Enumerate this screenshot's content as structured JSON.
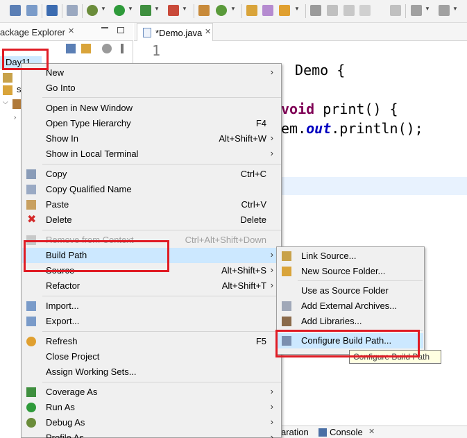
{
  "toolbar": {
    "icons": [
      "save-all-icon",
      "print-icon",
      "debug-icon",
      "run-icon",
      "coverage-icon",
      "external-tools-icon",
      "new-java-project-icon",
      "new-class-icon",
      "open-type-icon",
      "search-icon",
      "pin-icon",
      "annotation-icon",
      "paragraph-icon",
      "nav-back-icon",
      "nav-forward-icon"
    ]
  },
  "package_explorer": {
    "title": "ackage Explorer",
    "tree": [
      {
        "label": "Day11",
        "selected": true
      }
    ]
  },
  "editor": {
    "tab_label": "*Demo.java",
    "line_number": "1",
    "code": {
      "line1_text": " Demo {",
      "line2_keyword": "void",
      "line2_rest": " print() {",
      "line3_prefix": "em.",
      "line3_field": "out",
      "line3_rest": ".println();"
    }
  },
  "bottom_tabs": {
    "partial_tab": "aration",
    "console_tab": "Console"
  },
  "context_menu": {
    "items": [
      {
        "label": "New",
        "shortcut": "",
        "submenu": true
      },
      {
        "label": "Go Into",
        "shortcut": "",
        "submenu": false
      },
      {
        "label": "Open in New Window",
        "shortcut": "",
        "submenu": false
      },
      {
        "label": "Open Type Hierarchy",
        "shortcut": "F4",
        "submenu": false
      },
      {
        "label": "Show In",
        "shortcut": "Alt+Shift+W",
        "submenu": true
      },
      {
        "label": "Show in Local Terminal",
        "shortcut": "",
        "submenu": true
      },
      {
        "label": "Copy",
        "shortcut": "Ctrl+C",
        "submenu": false
      },
      {
        "label": "Copy Qualified Name",
        "shortcut": "",
        "submenu": false
      },
      {
        "label": "Paste",
        "shortcut": "Ctrl+V",
        "submenu": false
      },
      {
        "label": "Delete",
        "shortcut": "Delete",
        "submenu": false
      },
      {
        "label": "Remove from Context",
        "shortcut": "Ctrl+Alt+Shift+Down",
        "submenu": false,
        "disabled": true
      },
      {
        "label": "Build Path",
        "shortcut": "",
        "submenu": true,
        "selected": true
      },
      {
        "label": "Source",
        "shortcut": "Alt+Shift+S",
        "submenu": true
      },
      {
        "label": "Refactor",
        "shortcut": "Alt+Shift+T",
        "submenu": true
      },
      {
        "label": "Import...",
        "shortcut": "",
        "submenu": false
      },
      {
        "label": "Export...",
        "shortcut": "",
        "submenu": false
      },
      {
        "label": "Refresh",
        "shortcut": "F5",
        "submenu": false
      },
      {
        "label": "Close Project",
        "shortcut": "",
        "submenu": false
      },
      {
        "label": "Assign Working Sets...",
        "shortcut": "",
        "submenu": false
      },
      {
        "label": "Coverage As",
        "shortcut": "",
        "submenu": true
      },
      {
        "label": "Run As",
        "shortcut": "",
        "submenu": true
      },
      {
        "label": "Debug As",
        "shortcut": "",
        "submenu": true
      },
      {
        "label": "Profile As",
        "shortcut": "",
        "submenu": true
      }
    ]
  },
  "build_path_submenu": {
    "items": [
      {
        "label": "Link Source..."
      },
      {
        "label": "New Source Folder..."
      },
      {
        "label": "Use as Source Folder"
      },
      {
        "label": "Add External Archives..."
      },
      {
        "label": "Add Libraries..."
      },
      {
        "label": "Configure Build Path...",
        "selected": true
      }
    ]
  },
  "tooltip": {
    "text": "Configure Build Path"
  },
  "colors": {
    "highlight": "#cce8ff",
    "annotation_red": "#e01b24",
    "keyword": "#7f0055",
    "field": "#0000c0"
  }
}
